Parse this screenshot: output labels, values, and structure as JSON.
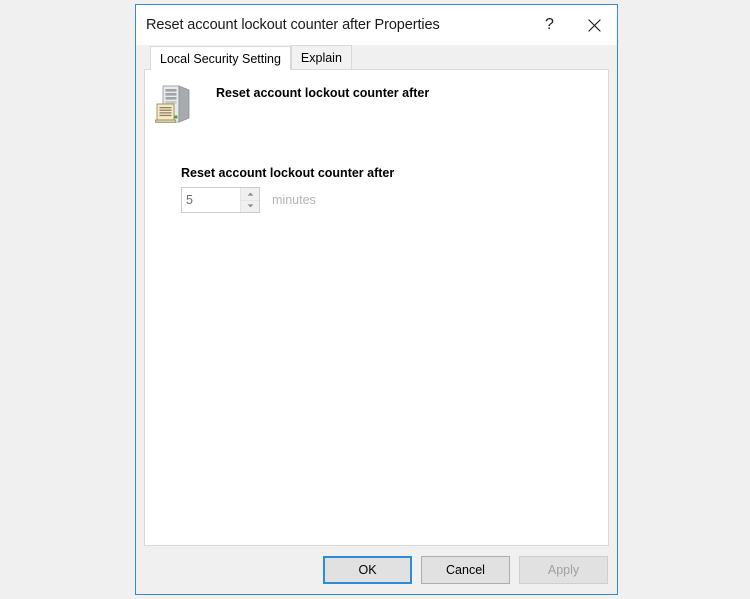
{
  "window": {
    "title": "Reset account lockout counter after Properties",
    "help_button": "?",
    "close_button": "✕"
  },
  "tabs": [
    {
      "label": "Local Security Setting",
      "active": true
    },
    {
      "label": "Explain",
      "active": false
    }
  ],
  "policy": {
    "icon": "security-policy-server-icon",
    "name": "Reset account lockout counter after"
  },
  "setting": {
    "label": "Reset account lockout counter after",
    "value": "5",
    "units": "minutes",
    "spinner_up": "spinner-up-arrow",
    "spinner_down": "spinner-down-arrow"
  },
  "buttons": {
    "ok": "OK",
    "cancel": "Cancel",
    "apply": "Apply"
  },
  "colors": {
    "accent": "#2e8bd6",
    "window_bg": "#f0f0f0",
    "panel_bg": "#ffffff",
    "disabled_text": "#a0a0a0",
    "units_text": "#b3b3b3"
  }
}
